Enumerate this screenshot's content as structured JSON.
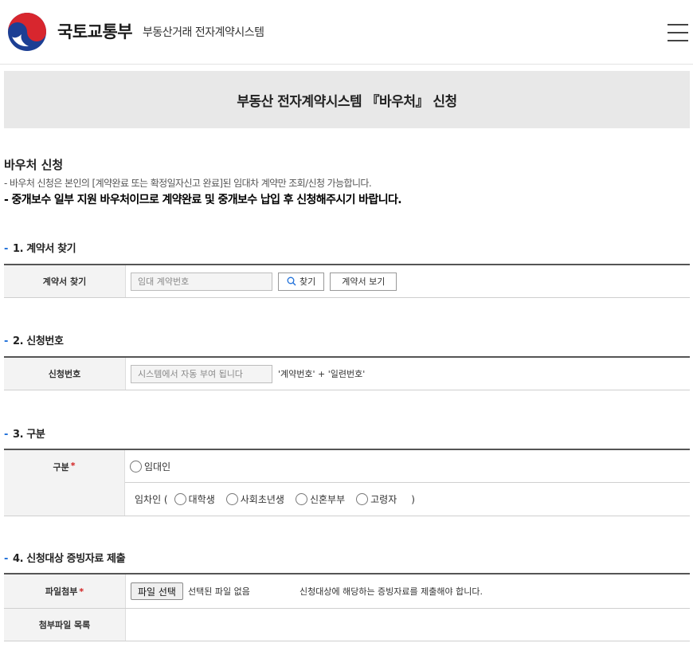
{
  "header": {
    "org_name": "국토교통부",
    "org_subtitle": "부동산거래 전자계약시스템",
    "menu_icon": "hamburger-menu-icon"
  },
  "page_title": "부동산 전자계약시스템 『바우처』 신청",
  "intro": {
    "title": "바우처 신청",
    "note": "- 바우처 신청은 본인의 [계약완료 또는 확정일자신고 완료]된 임대차 계약만 조회/신청 가능합니다.",
    "notice": "- 중개보수 일부 지원 바우처이므로 계약완료 및 중개보수 납입 후 신청해주시기 바랍니다."
  },
  "section1": {
    "title": "1. 계약서 찾기",
    "label": "계약서 찾기",
    "input_placeholder": "임대 계약번호",
    "search_button": "찾기",
    "search_icon": "search-icon",
    "view_button": "계약서 보기"
  },
  "section2": {
    "title": "2. 신청번호",
    "label": "신청번호",
    "input_placeholder": "시스템에서 자동 부여 됩니다",
    "hint": "'계약번호' + '일련번호'"
  },
  "section3": {
    "title": "3. 구분",
    "label": "구분",
    "required_mark": "*",
    "option_landlord": "임대인",
    "tenant_prefix": "임차인 (",
    "tenant_options": [
      "대학생",
      "사회초년생",
      "신혼부부",
      "고령자"
    ],
    "tenant_suffix": ")"
  },
  "section4": {
    "title": "4. 신청대상 증빙자료 제출",
    "attach_label": "파일첨부",
    "required_mark": "*",
    "file_button": "파일 선택",
    "file_status": "선택된 파일 없음",
    "attach_hint": "신청대상에 해당하는 증빙자료를 제출해야 합니다.",
    "list_label": "첨부파일 목록"
  },
  "colors": {
    "accent_blue": "#1e6fd9",
    "required_red": "#d21f1f",
    "band_gray": "#e8e8e8"
  }
}
